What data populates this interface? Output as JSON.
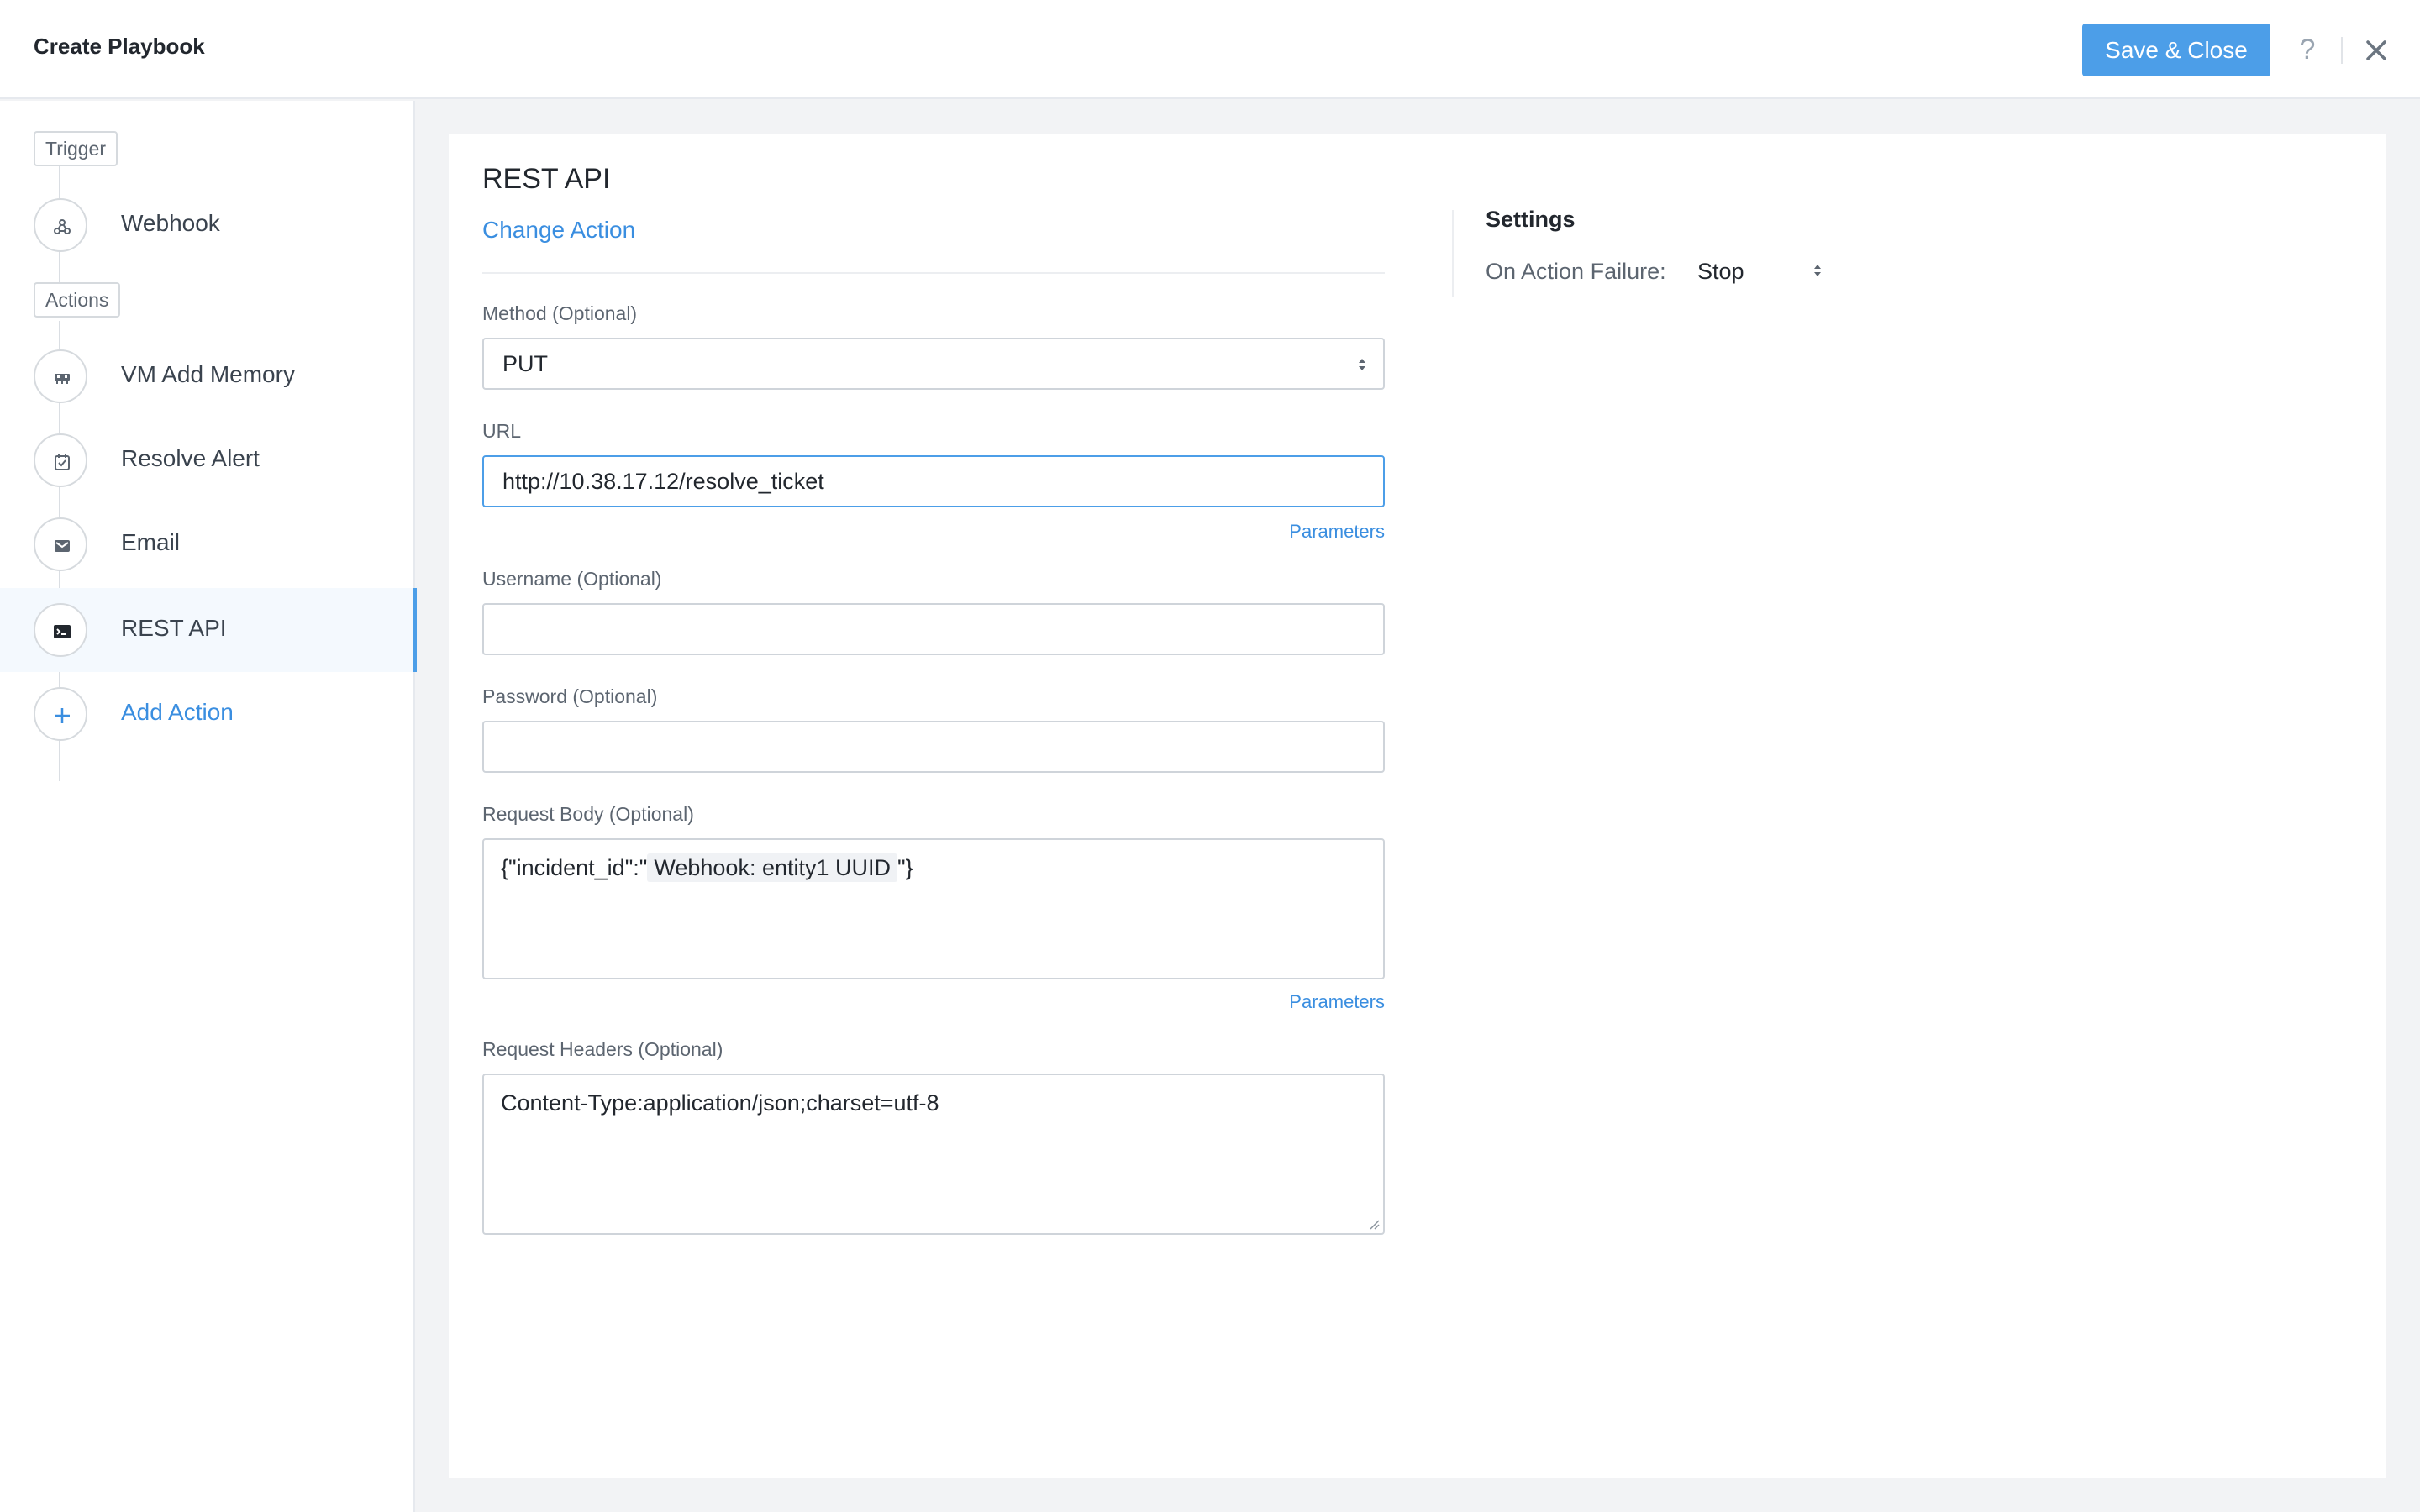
{
  "header": {
    "title": "Create Playbook",
    "save_label": "Save & Close",
    "help_label": "?"
  },
  "sidebar": {
    "trigger_tag": "Trigger",
    "actions_tag": "Actions",
    "steps": [
      {
        "label": "Webhook",
        "icon": "webhook-icon"
      },
      {
        "label": "VM Add Memory",
        "icon": "memory-icon"
      },
      {
        "label": "Resolve Alert",
        "icon": "resolve-alert-icon"
      },
      {
        "label": "Email",
        "icon": "email-icon"
      },
      {
        "label": "REST API",
        "icon": "terminal-icon",
        "active": true
      }
    ],
    "add_action_label": "Add Action"
  },
  "main": {
    "title": "REST API",
    "change_action_label": "Change Action",
    "method": {
      "label": "Method (Optional)",
      "value": "PUT"
    },
    "url": {
      "label": "URL",
      "value": "http://10.38.17.12/resolve_ticket"
    },
    "parameters_label": "Parameters",
    "username": {
      "label": "Username (Optional)",
      "value": ""
    },
    "password": {
      "label": "Password (Optional)",
      "value": ""
    },
    "request_body": {
      "label": "Request Body (Optional)",
      "prefix": "{\"incident_id\":\"",
      "token": "Webhook: entity1 UUID",
      "suffix": "\"}"
    },
    "request_headers": {
      "label": "Request Headers (Optional)",
      "value": "Content-Type:application/json;charset=utf-8"
    }
  },
  "settings": {
    "title": "Settings",
    "failure_label": "On Action Failure:",
    "failure_value": "Stop"
  },
  "colors": {
    "accent": "#4c9ee8",
    "link": "#3a8ee0",
    "active_bg": "#f4f9fe"
  }
}
